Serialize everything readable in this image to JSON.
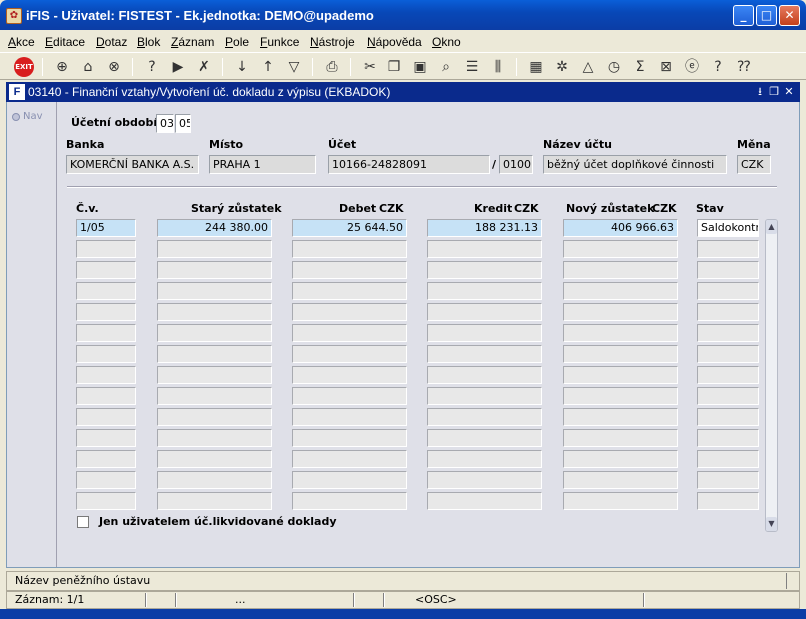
{
  "window": {
    "title": "iFIS - Uživatel: FISTEST - Ek.jednotka: DEMO@upademo",
    "app_icon": "iFIS-logo-icon"
  },
  "menu": [
    "Akce",
    "Editace",
    "Dotaz",
    "Blok",
    "Záznam",
    "Pole",
    "Funkce",
    "Nástroje",
    "Nápověda",
    "Okno"
  ],
  "toolbar": {
    "exit_label": "EXIT",
    "icons": [
      "exit-icon",
      "insert-record-icon",
      "lock-icon",
      "delete-record-icon",
      "enter-query-icon",
      "execute-query-icon",
      "cancel-query-icon",
      "sort-asc-icon",
      "sort-desc-icon",
      "filter-icon",
      "print-icon",
      "cut-icon",
      "copy-icon",
      "paste-icon",
      "search-icon",
      "align-icon",
      "columns-icon",
      "calculator-icon",
      "settings-icon",
      "chart-icon",
      "clock-icon",
      "sum-icon",
      "excel-icon",
      "internet-icon",
      "help-icon",
      "context-help-icon"
    ]
  },
  "form": {
    "title": "03140 - Finanční vztahy/Vytvoření úč. dokladu z výpisu (EKBADOK)",
    "nav_label": "Nav",
    "period_label": "Účetní období",
    "period_month": "03",
    "period_year": "05",
    "labels": {
      "bank": "Banka",
      "place": "Místo",
      "account": "Účet",
      "account_name": "Název účtu",
      "currency": "Měna"
    },
    "values": {
      "bank": "KOMERČNÍ BANKA A.S.",
      "place": "PRAHA 1",
      "account": "10166-24828091",
      "bank_code_sep": "/",
      "bank_code": "0100",
      "account_name": "běžný účet doplňkové činnosti",
      "currency": "CZK"
    },
    "columns": {
      "cv": "Č.v.",
      "old_balance": "Starý zůstatek",
      "debit": "Debet",
      "debit_cur": "CZK",
      "credit": "Kredit",
      "credit_cur": "CZK",
      "new_balance": "Nový zůstatek",
      "new_cur": "CZK",
      "status": "Stav"
    },
    "rows": [
      {
        "cv": "1/05",
        "old_balance": "244 380.00",
        "debit": "25 644.50",
        "credit": "188 231.13",
        "new_balance": "406 966.63",
        "status": "Saldokontně"
      }
    ],
    "empty_rows": 13,
    "checkbox_label": "Jen uživatelem úč.likvidované doklady",
    "checkbox_checked": false
  },
  "status": {
    "hint": "Název peněžního ústavu",
    "record": "Záznam: 1/1",
    "dots": "...",
    "osc": "<OSC>"
  }
}
